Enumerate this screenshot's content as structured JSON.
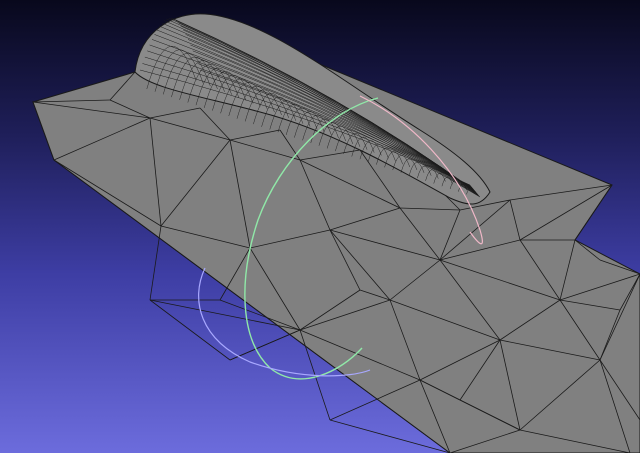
{
  "viewport": {
    "background_top": "#08081c",
    "background_bottom": "#6c6cdc"
  },
  "mesh": {
    "face_color": "#808080",
    "face_dark": "#6e6e6e",
    "side_color": "#747474",
    "edge_color": "#1a1a1a",
    "solid_color": "#8a8a8a"
  },
  "trackball": {
    "vertical_ring_color": "#90e8a8",
    "horizontal_ring_color": "#a8a8ff",
    "tilted_ring_color": "#f0b8c8"
  }
}
